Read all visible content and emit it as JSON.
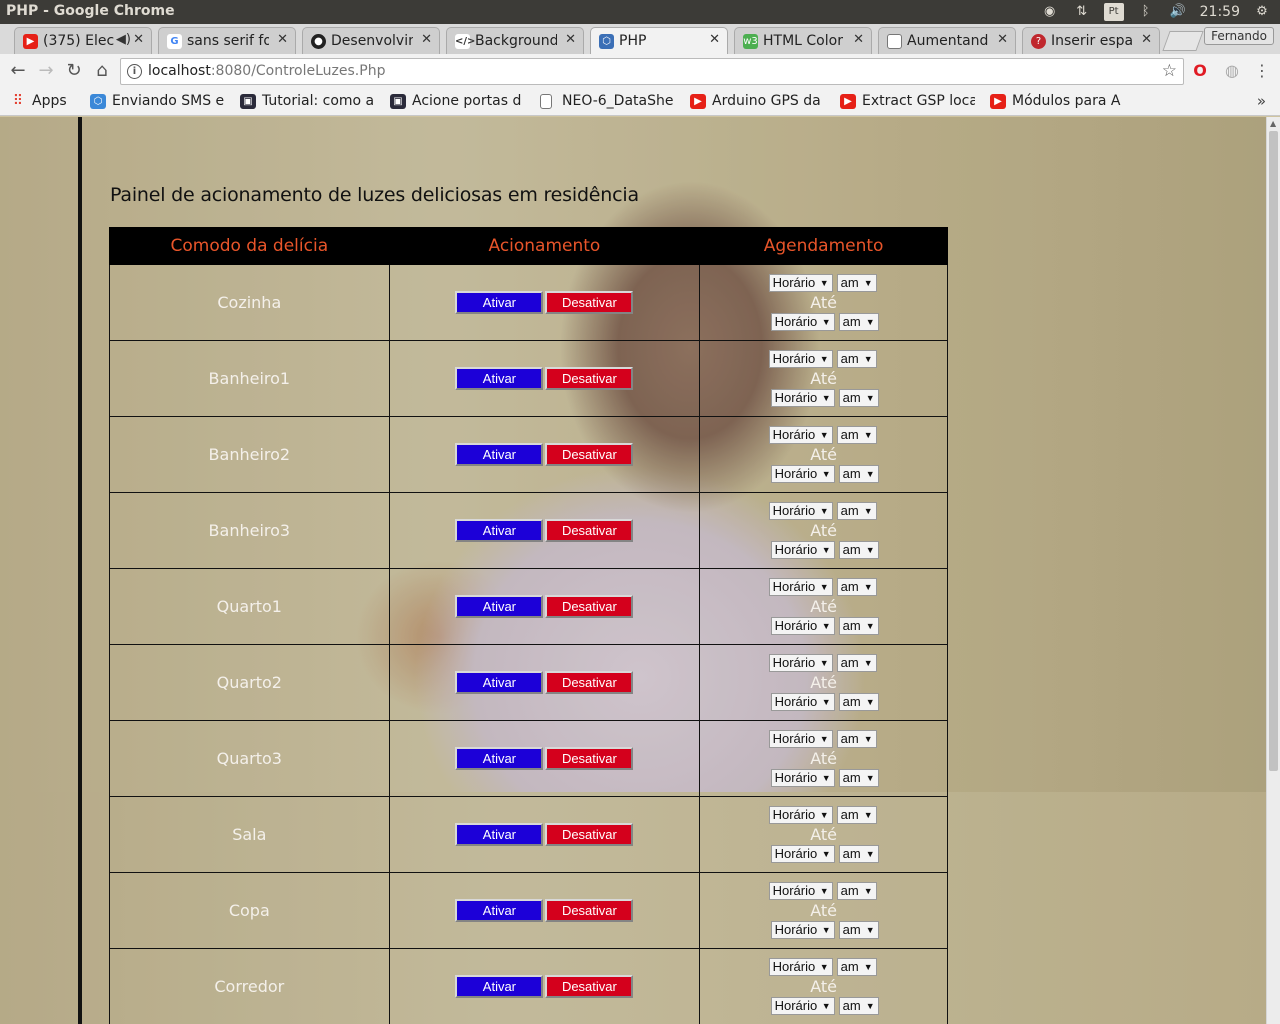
{
  "os": {
    "window_title": "PHP - Google Chrome",
    "lang": "Pt",
    "clock": "21:59"
  },
  "tabs": [
    {
      "label": "(375) Elec",
      "icon": "youtube-icon",
      "color": "#e62117"
    },
    {
      "label": "sans serif fo",
      "icon": "google-icon",
      "color": "#4285f4"
    },
    {
      "label": "Desenvolvin",
      "icon": "github-icon",
      "color": "#222222"
    },
    {
      "label": "Background",
      "icon": "code-icon",
      "color": "#333333"
    },
    {
      "label": "PHP",
      "icon": "php-icon",
      "color": "#3b6fb6"
    },
    {
      "label": "HTML Color",
      "icon": "w3-icon",
      "color": "#4caf50"
    },
    {
      "label": "Aumentand",
      "icon": "page-icon",
      "color": "#777777"
    },
    {
      "label": "Inserir espa",
      "icon": "quora-icon",
      "color": "#c0272d"
    }
  ],
  "profile_name": "Fernando",
  "toolbar": {
    "url_host": "localhost",
    "url_rest": ":8080/ControleLuzes.Php"
  },
  "bookmarks": [
    {
      "label": "Apps",
      "icon": "apps-icon",
      "color": "#e34133"
    },
    {
      "label": "Enviando SMS e",
      "icon": "bookmark-icon",
      "color": "#3b88d8"
    },
    {
      "label": "Tutorial: como a",
      "icon": "bookmark-icon",
      "color": "#2a2a3a"
    },
    {
      "label": "Acione portas d",
      "icon": "bookmark-icon",
      "color": "#2a2a3a"
    },
    {
      "label": "NEO-6_DataShe",
      "icon": "page-icon",
      "color": "#777777"
    },
    {
      "label": "Arduino GPS da",
      "icon": "youtube-icon",
      "color": "#e62117"
    },
    {
      "label": "Extract GSP loca",
      "icon": "youtube-icon",
      "color": "#e62117"
    },
    {
      "label": "Módulos para A",
      "icon": "youtube-icon",
      "color": "#e62117"
    }
  ],
  "page": {
    "title": "Painel de acionamento de luzes deliciosas em residência",
    "headers": {
      "room": "Comodo da delícia",
      "action": "Acionamento",
      "schedule": "Agendamento"
    },
    "on_label": "Ativar",
    "off_label": "Desativar",
    "hour_placeholder": "Horário",
    "ampm_value": "am",
    "until_label": "Até",
    "rooms": [
      "Cozinha",
      "Banheiro1",
      "Banheiro2",
      "Banheiro3",
      "Quarto1",
      "Quarto2",
      "Quarto3",
      "Sala",
      "Copa",
      "Corredor"
    ]
  },
  "colors": {
    "header_text": "#e8552a",
    "on_button": "#1c00d8",
    "off_button": "#d4001c"
  }
}
